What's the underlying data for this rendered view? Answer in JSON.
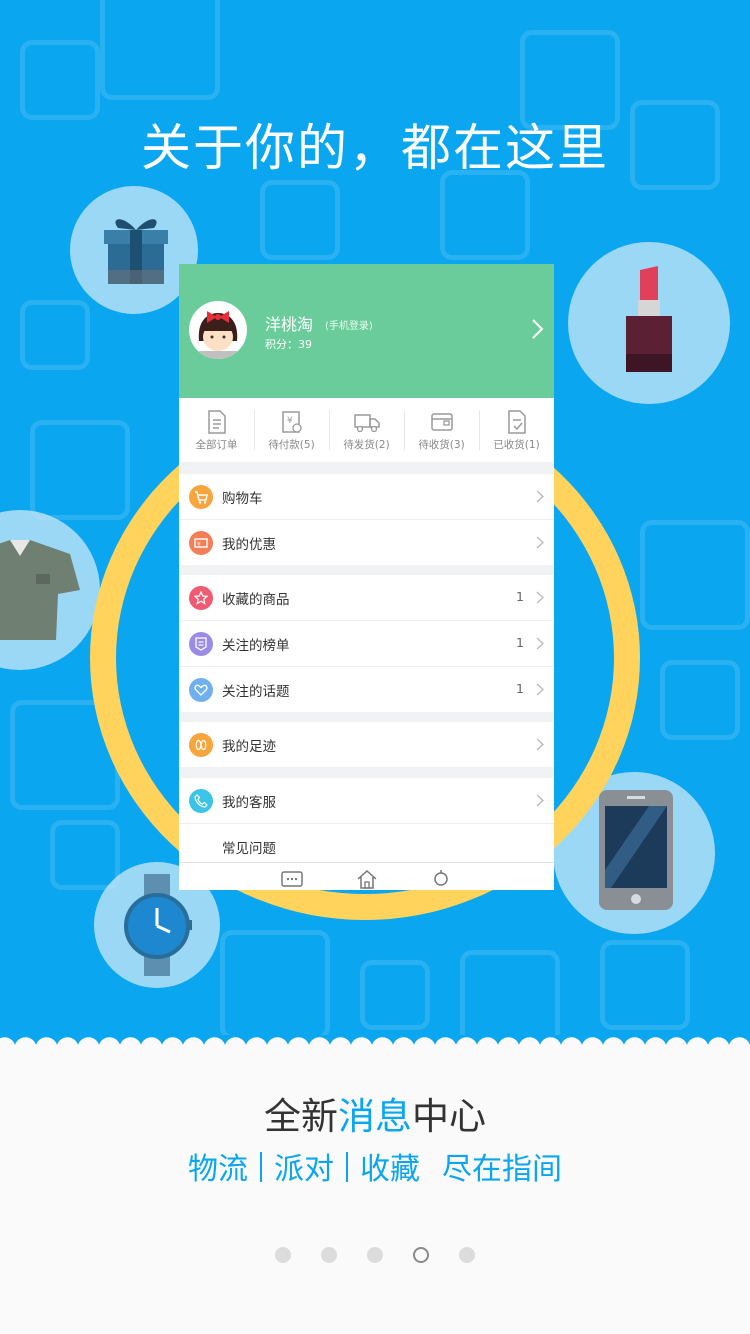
{
  "hero": {
    "headline": "关于你的，都在这里"
  },
  "phone": {
    "profile": {
      "name": "洋桃淘",
      "login_hint": "(手机登录)",
      "points": "积分：39"
    },
    "orders": [
      {
        "label": "全部订单",
        "icon": "order-list-icon"
      },
      {
        "label": "待付款(5)",
        "icon": "wallet-yen-icon"
      },
      {
        "label": "待发货(2)",
        "icon": "truck-icon"
      },
      {
        "label": "待收货(3)",
        "icon": "package-icon"
      },
      {
        "label": "已收货(1)",
        "icon": "received-icon"
      }
    ],
    "menu": {
      "cart": "购物车",
      "coupons": "我的优惠",
      "fav_goods": "收藏的商品",
      "fav_goods_count": "1",
      "followed_lists": "关注的榜单",
      "followed_lists_count": "1",
      "followed_topics": "关注的话题",
      "followed_topics_count": "1",
      "footprints": "我的足迹",
      "service": "我的客服",
      "faq": "常见问题"
    }
  },
  "colors": {
    "hero_bg": "#0aa6ef",
    "profile_bg": "#6acc9a",
    "ring": "#ffd35c",
    "accent": "#0aa6ef"
  },
  "footer": {
    "slogan_pre": "全新",
    "slogan_highlight": "消息",
    "slogan_post": "中心",
    "tags": [
      "物流",
      "派对",
      "收藏",
      "尽在指间"
    ]
  },
  "pager": {
    "total": 5,
    "current": 4
  }
}
